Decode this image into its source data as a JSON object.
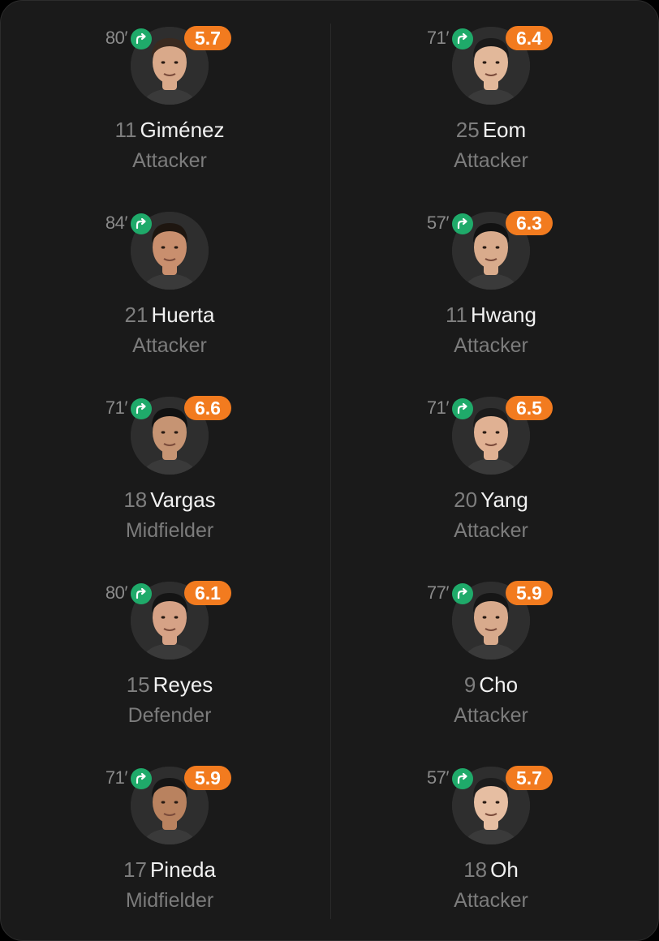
{
  "left_team": [
    {
      "minute": "80′",
      "rating": "5.7",
      "number": "11",
      "name": "Giménez",
      "position": "Attacker",
      "skin": "#d9a98a",
      "hair": "#3a2a20"
    },
    {
      "minute": "84′",
      "rating": "",
      "number": "21",
      "name": "Huerta",
      "position": "Attacker",
      "skin": "#c98f6e",
      "hair": "#1e1610"
    },
    {
      "minute": "71′",
      "rating": "6.6",
      "number": "18",
      "name": "Vargas",
      "position": "Midfielder",
      "skin": "#c69473",
      "hair": "#111111"
    },
    {
      "minute": "80′",
      "rating": "6.1",
      "number": "15",
      "name": "Reyes",
      "position": "Defender",
      "skin": "#d6a286",
      "hair": "#141414"
    },
    {
      "minute": "71′",
      "rating": "5.9",
      "number": "17",
      "name": "Pineda",
      "position": "Midfielder",
      "skin": "#b9825f",
      "hair": "#151515"
    }
  ],
  "right_team": [
    {
      "minute": "71′",
      "rating": "6.4",
      "number": "25",
      "name": "Eom",
      "position": "Attacker",
      "skin": "#e2b89a",
      "hair": "#1a1a1a"
    },
    {
      "minute": "57′",
      "rating": "6.3",
      "number": "11",
      "name": "Hwang",
      "position": "Attacker",
      "skin": "#d9ab8c",
      "hair": "#121212"
    },
    {
      "minute": "71′",
      "rating": "6.5",
      "number": "20",
      "name": "Yang",
      "position": "Attacker",
      "skin": "#e0b193",
      "hair": "#1b1b1b"
    },
    {
      "minute": "77′",
      "rating": "5.9",
      "number": "9",
      "name": "Cho",
      "position": "Attacker",
      "skin": "#d8aa8c",
      "hair": "#161616"
    },
    {
      "minute": "57′",
      "rating": "5.7",
      "number": "18",
      "name": "Oh",
      "position": "Attacker",
      "skin": "#e6bea2",
      "hair": "#1c1c1c"
    }
  ],
  "colors": {
    "sub_icon": "#1faa6a",
    "rating_badge": "#f27b1f"
  },
  "icons": {
    "sub": "substitution-out-icon"
  }
}
